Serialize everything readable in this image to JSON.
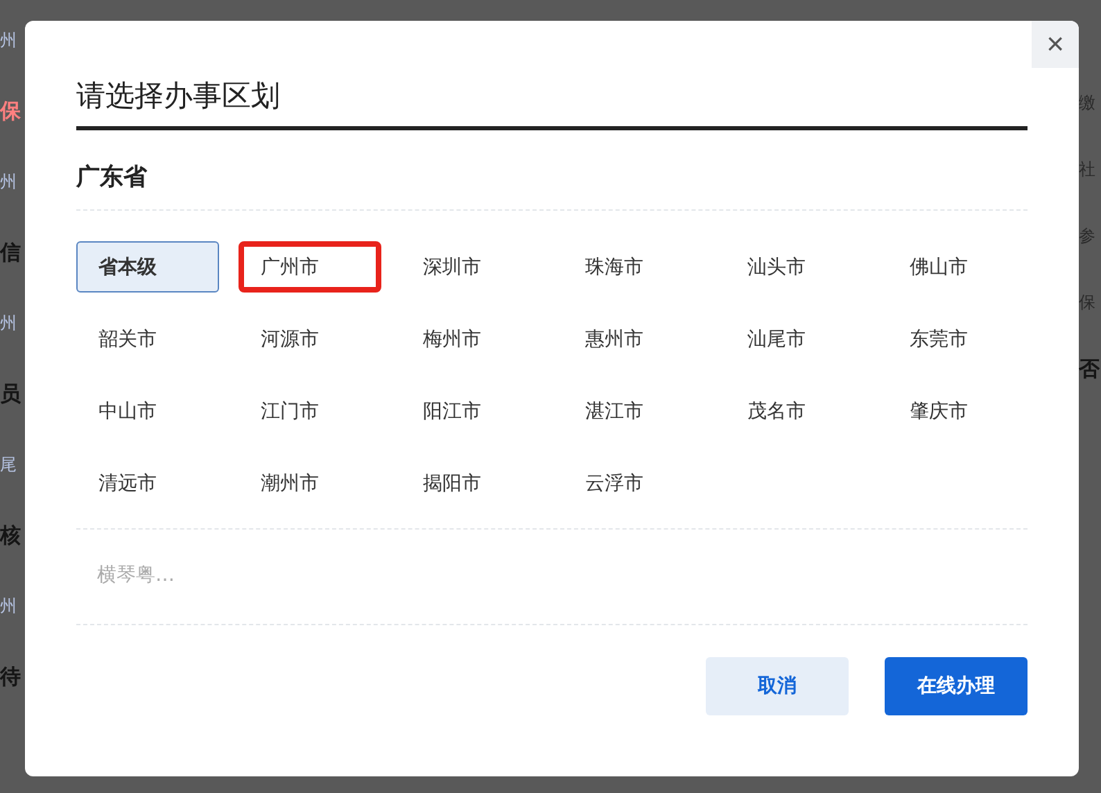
{
  "background": {
    "left_fragments": [
      {
        "text": "州",
        "kind": "link"
      },
      {
        "text": "保",
        "kind": "alert"
      },
      {
        "text": "州",
        "kind": "link"
      },
      {
        "text": "信",
        "kind": "heading"
      },
      {
        "text": "州",
        "kind": "link"
      },
      {
        "text": "员",
        "kind": "heading"
      },
      {
        "text": "尾",
        "kind": "link"
      },
      {
        "text": "核",
        "kind": "heading"
      },
      {
        "text": "州",
        "kind": "link"
      },
      {
        "text": "待",
        "kind": "heading"
      }
    ],
    "right_fragments": [
      {
        "text": "缴",
        "kind": "plain"
      },
      {
        "text": "社",
        "kind": "plain"
      },
      {
        "text": "参",
        "kind": "plain"
      },
      {
        "text": "保",
        "kind": "plain"
      },
      {
        "text": "否",
        "kind": "heading"
      }
    ]
  },
  "dialog": {
    "title": "请选择办事区划",
    "close": "×",
    "province": "广东省",
    "regions": [
      {
        "label": "省本级",
        "selected": true,
        "highlighted": false
      },
      {
        "label": "广州市",
        "selected": false,
        "highlighted": true
      },
      {
        "label": "深圳市",
        "selected": false,
        "highlighted": false
      },
      {
        "label": "珠海市",
        "selected": false,
        "highlighted": false
      },
      {
        "label": "汕头市",
        "selected": false,
        "highlighted": false
      },
      {
        "label": "佛山市",
        "selected": false,
        "highlighted": false
      },
      {
        "label": "韶关市",
        "selected": false,
        "highlighted": false
      },
      {
        "label": "河源市",
        "selected": false,
        "highlighted": false
      },
      {
        "label": "梅州市",
        "selected": false,
        "highlighted": false
      },
      {
        "label": "惠州市",
        "selected": false,
        "highlighted": false
      },
      {
        "label": "汕尾市",
        "selected": false,
        "highlighted": false
      },
      {
        "label": "东莞市",
        "selected": false,
        "highlighted": false
      },
      {
        "label": "中山市",
        "selected": false,
        "highlighted": false
      },
      {
        "label": "江门市",
        "selected": false,
        "highlighted": false
      },
      {
        "label": "阳江市",
        "selected": false,
        "highlighted": false
      },
      {
        "label": "湛江市",
        "selected": false,
        "highlighted": false
      },
      {
        "label": "茂名市",
        "selected": false,
        "highlighted": false
      },
      {
        "label": "肇庆市",
        "selected": false,
        "highlighted": false
      },
      {
        "label": "清远市",
        "selected": false,
        "highlighted": false
      },
      {
        "label": "潮州市",
        "selected": false,
        "highlighted": false
      },
      {
        "label": "揭阳市",
        "selected": false,
        "highlighted": false
      },
      {
        "label": "云浮市",
        "selected": false,
        "highlighted": false
      }
    ],
    "extra": {
      "label": "横琴粤…",
      "disabled": true
    },
    "buttons": [
      {
        "label": "取消",
        "kind": "secondary"
      },
      {
        "label": "在线办理",
        "kind": "primary"
      }
    ]
  }
}
